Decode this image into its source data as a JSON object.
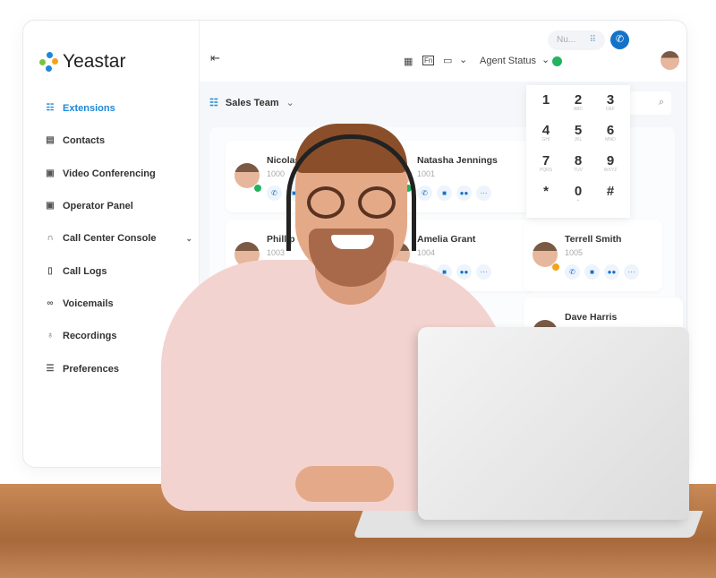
{
  "brand": {
    "name": "Yeastar"
  },
  "sidebar": {
    "items": [
      {
        "label": "Extensions",
        "icon": "user-list-icon",
        "active": true
      },
      {
        "label": "Contacts",
        "icon": "contacts-icon"
      },
      {
        "label": "Video Conferencing",
        "icon": "video-conference-icon"
      },
      {
        "label": "Operator Panel",
        "icon": "operator-panel-icon"
      },
      {
        "label": "Call Center Console",
        "icon": "headset-icon",
        "has_submenu": true
      },
      {
        "label": "Call Logs",
        "icon": "call-log-icon"
      },
      {
        "label": "Voicemails",
        "icon": "voicemail-icon"
      },
      {
        "label": "Recordings",
        "icon": "microphone-icon"
      },
      {
        "label": "Preferences",
        "icon": "preferences-icon"
      }
    ]
  },
  "topbar": {
    "agent_status": "Agent Status",
    "status_color": "#22b35e",
    "number_placeholder": "Nu...",
    "accent": "#1473c9"
  },
  "main": {
    "group": "Sales Team"
  },
  "extensions": [
    {
      "name": "Nicolas",
      "ext": "1000",
      "status": "available",
      "status_color": "#22b35e"
    },
    {
      "name": "Natasha Jennings",
      "ext": "1001",
      "status": "available",
      "status_color": "#22b35e"
    },
    {
      "name": "Phillip",
      "ext": "1003",
      "status": "busy",
      "status_color": "#f4a31c"
    },
    {
      "name": "Amelia Grant",
      "ext": "1004",
      "status": "available",
      "status_color": "#22b35e"
    },
    {
      "name": "Terrell Smith",
      "ext": "1005",
      "status": "busy",
      "status_color": "#f4a31c"
    },
    {
      "name": "Dave Harris",
      "ext": "",
      "status": "",
      "status_color": ""
    }
  ],
  "dialpad": [
    {
      "d": "1",
      "l": ""
    },
    {
      "d": "2",
      "l": "ABC"
    },
    {
      "d": "3",
      "l": "DEF"
    },
    {
      "d": "4",
      "l": "GHI"
    },
    {
      "d": "5",
      "l": "JKL"
    },
    {
      "d": "6",
      "l": "MNO"
    },
    {
      "d": "7",
      "l": "PQRS"
    },
    {
      "d": "8",
      "l": "TUV"
    },
    {
      "d": "9",
      "l": "WXYZ"
    },
    {
      "d": "*",
      "l": ""
    },
    {
      "d": "0",
      "l": "+"
    },
    {
      "d": "#",
      "l": ""
    }
  ]
}
